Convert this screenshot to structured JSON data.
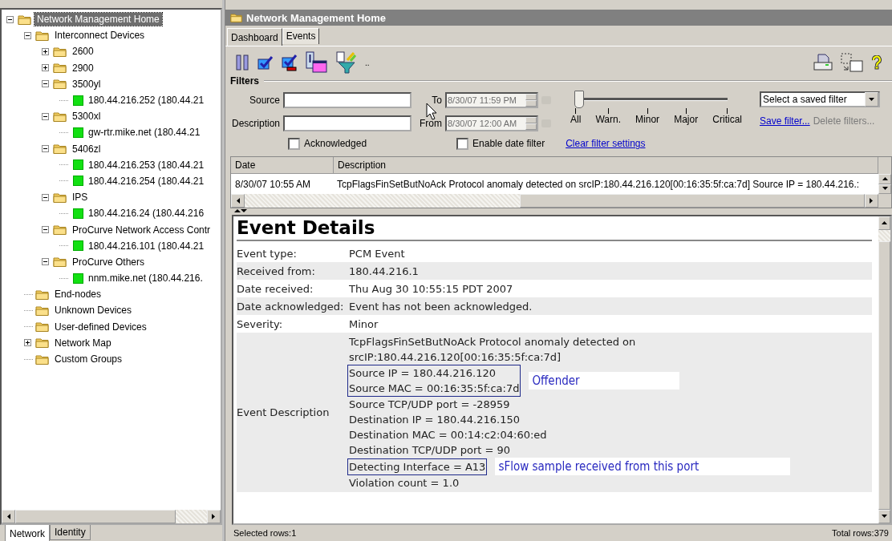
{
  "tree": [
    {
      "label": "Network Management Home",
      "kind": "folder",
      "expanded": true,
      "selected": true,
      "children": [
        {
          "label": "Interconnect Devices",
          "kind": "folder",
          "expanded": true,
          "selected": false,
          "children": [
            {
              "label": "2600",
              "kind": "folder",
              "expanded": false,
              "selected": false
            },
            {
              "label": "2900",
              "kind": "folder",
              "expanded": false,
              "selected": false
            },
            {
              "label": "3500yl",
              "kind": "folder",
              "expanded": true,
              "selected": false,
              "children": [
                {
                  "label": "180.44.216.252 (180.44.21",
                  "kind": "device",
                  "selected": false
                }
              ]
            },
            {
              "label": "5300xl",
              "kind": "folder",
              "expanded": true,
              "selected": false,
              "children": [
                {
                  "label": "gw-rtr.mike.net (180.44.21",
                  "kind": "device",
                  "selected": false
                }
              ]
            },
            {
              "label": "5406zl",
              "kind": "folder",
              "expanded": true,
              "selected": false,
              "children": [
                {
                  "label": "180.44.216.253 (180.44.21",
                  "kind": "device",
                  "selected": false
                },
                {
                  "label": "180.44.216.254 (180.44.21",
                  "kind": "device",
                  "selected": false
                }
              ]
            },
            {
              "label": "IPS",
              "kind": "folder",
              "expanded": true,
              "selected": false,
              "children": [
                {
                  "label": "180.44.216.24 (180.44.216",
                  "kind": "device",
                  "selected": false
                }
              ]
            },
            {
              "label": "ProCurve Network Access Contr",
              "kind": "folder",
              "expanded": true,
              "selected": false,
              "children": [
                {
                  "label": "180.44.216.101 (180.44.21",
                  "kind": "device",
                  "selected": false
                }
              ]
            },
            {
              "label": "ProCurve Others",
              "kind": "folder",
              "expanded": true,
              "selected": false,
              "children": [
                {
                  "label": "nnm.mike.net (180.44.216.",
                  "kind": "device",
                  "selected": false
                }
              ]
            }
          ]
        },
        {
          "label": "End-nodes",
          "kind": "folder",
          "selected": false
        },
        {
          "label": "Unknown Devices",
          "kind": "folder",
          "selected": false
        },
        {
          "label": "User-defined Devices",
          "kind": "folder",
          "selected": false
        },
        {
          "label": "Network Map",
          "kind": "folder",
          "expanded": false,
          "selected": false
        },
        {
          "label": "Custom Groups",
          "kind": "folder",
          "selected": false
        }
      ]
    }
  ],
  "left_tabs": [
    {
      "label": "Network",
      "selected": true
    },
    {
      "label": "Identity",
      "selected": false
    }
  ],
  "panel_title": "Network Management Home",
  "tabs": [
    {
      "label": "Dashboard",
      "selected": false
    },
    {
      "label": "Events",
      "selected": true
    }
  ],
  "toolbar_more": "..",
  "filters": {
    "title": "Filters",
    "source": {
      "label": "Source"
    },
    "description": {
      "label": "Description"
    },
    "to": {
      "label": "To",
      "value": "8/30/07 11:59 PM",
      "disabled": true
    },
    "from": {
      "label": "From",
      "value": "8/30/07 12:00 AM",
      "disabled": true
    },
    "severity": {
      "level": 0,
      "ticks": [
        "All",
        "Warn.",
        "Minor",
        "Major",
        "Critical"
      ]
    },
    "saved_filter": {
      "value": "Select a saved filter"
    },
    "save_link": "Save filter...",
    "delete_link": {
      "label": "Delete filters...",
      "disabled": true
    },
    "acknowledged": {
      "label": "Acknowledged",
      "checked": false
    },
    "enable_date": {
      "label": "Enable date filter",
      "checked": false
    },
    "clear_link": "Clear filter settings"
  },
  "table": {
    "columns": [
      "Date",
      "Description"
    ],
    "rows": [
      {
        "date": "8/30/07 10:55 AM",
        "description": "TcpFlagsFinSetButNoAck Protocol anomaly detected on srcIP:180.44.216.120[00:16:35:5f:ca:7d] Source IP = 180.44.216.:",
        "selected": false
      }
    ]
  },
  "details": {
    "title": "Event Details",
    "rows": [
      {
        "label": "Event type:",
        "value": "PCM Event"
      },
      {
        "label": "Received from:",
        "value": "180.44.216.1"
      },
      {
        "label": "Date received:",
        "value": "Thu Aug 30 10:55:15 PDT 2007"
      },
      {
        "label": "Date acknowledged:",
        "value": "Event has not been acknowledged."
      },
      {
        "label": "Severity:",
        "value": "Minor"
      }
    ],
    "description": {
      "label": "Event Description",
      "blocks": [
        {
          "lines": [
            "TcpFlagsFinSetButNoAck Protocol anomaly detected on",
            "srcIP:180.44.216.120[00:16:35:5f:ca:7d]"
          ],
          "kind": "plain"
        },
        {
          "lines": [
            "Source IP = 180.44.216.120",
            "Source MAC = 00:16:35:5f:ca:7d"
          ],
          "kind": "boxed",
          "note": "Offender"
        },
        {
          "lines": [
            "Source TCP/UDP port = -28959",
            "Destination IP = 180.44.216.150",
            "Destination MAC = 00:14:c2:04:60:ed",
            "Destination TCP/UDP port = 90"
          ],
          "kind": "plain"
        },
        {
          "lines": [
            "Detecting Interface = A13"
          ],
          "kind": "boxed",
          "note": "sFlow sample received from this port"
        },
        {
          "lines": [
            "Violation count = 1.0"
          ],
          "kind": "plain"
        }
      ]
    }
  },
  "status": {
    "selected": "Selected rows:1",
    "total": "Total rows:379"
  }
}
